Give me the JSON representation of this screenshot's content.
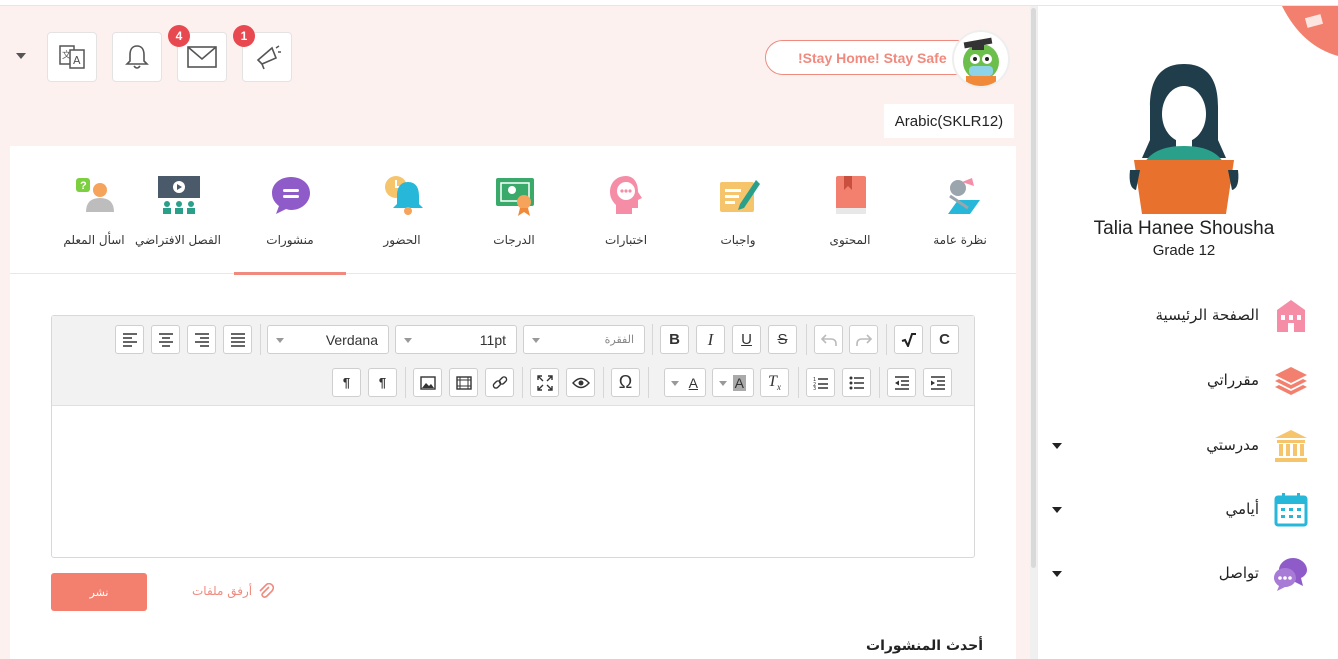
{
  "header": {
    "badges": {
      "messages": "4",
      "announcements": "1"
    },
    "banner": "!Stay Home! Stay Safe",
    "course": "Arabic(SKLR12)"
  },
  "tabs": [
    {
      "label": "نظرة عامة",
      "icon": "overview-icon"
    },
    {
      "label": "المحتوى",
      "icon": "book-icon"
    },
    {
      "label": "واجبات",
      "icon": "assignment-icon"
    },
    {
      "label": "اختبارات",
      "icon": "quiz-icon"
    },
    {
      "label": "الدرجات",
      "icon": "grades-certificate-icon"
    },
    {
      "label": "الحضور",
      "icon": "attendance-bell-icon"
    },
    {
      "label": "منشورات",
      "icon": "posts-chat-icon"
    },
    {
      "label": "الفصل الافتراضي",
      "icon": "virtual-class-icon"
    },
    {
      "label": "اسأل المعلم",
      "icon": "ask-teacher-icon"
    }
  ],
  "active_tab": "منشورات",
  "editor": {
    "paragraph_placeholder": "الفقرة",
    "font_size": "11pt",
    "font_family": "Verdana"
  },
  "actions": {
    "publish": "نشر",
    "attach": "أرفق ملفات"
  },
  "latest_posts": "أحدث المنشورات",
  "user": {
    "name": "Talia Hanee Shousha",
    "grade": "Grade 12"
  },
  "nav": [
    {
      "label": "الصفحة الرئيسية",
      "icon": "school-home-icon",
      "dropdown": false
    },
    {
      "label": "مقرراتي",
      "icon": "layers-icon",
      "dropdown": false
    },
    {
      "label": "مدرستي",
      "icon": "building-icon",
      "dropdown": true
    },
    {
      "label": "أيامي",
      "icon": "calendar-icon",
      "dropdown": true
    },
    {
      "label": "تواصل",
      "icon": "chat-bubbles-icon",
      "dropdown": true
    }
  ],
  "colors": {
    "accent": "#f3806e",
    "background": "#fdf1ef",
    "badge": "#e8484f"
  }
}
